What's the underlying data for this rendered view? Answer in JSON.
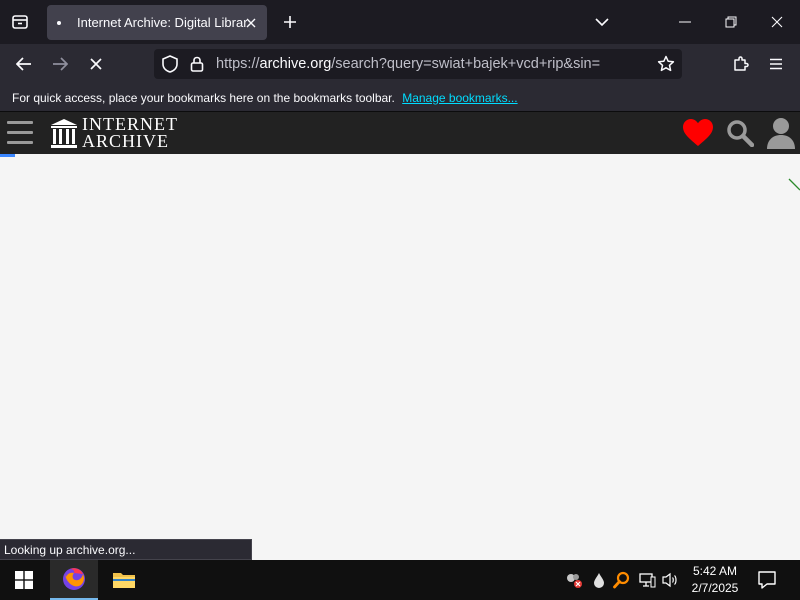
{
  "browser": {
    "tab": {
      "title": "Internet Archive: Digital Library"
    },
    "url": {
      "scheme": "https://",
      "host": "archive.org",
      "path": "/search?query=swiat+bajek+vcd+rip&sin="
    },
    "bookmarks_bar": {
      "message": "For quick access, place your bookmarks here on the bookmarks toolbar.",
      "link": "Manage bookmarks..."
    },
    "status_text": "Looking up archive.org..."
  },
  "site": {
    "logo_line1": "INTERNET",
    "logo_line2": "ARCHIVE"
  },
  "taskbar": {
    "time": "5:42 AM",
    "date": "2/7/2025"
  },
  "colors": {
    "accent_link": "#00ddff",
    "heart": "#ff0000",
    "loading_bar": "#3a86ff"
  }
}
